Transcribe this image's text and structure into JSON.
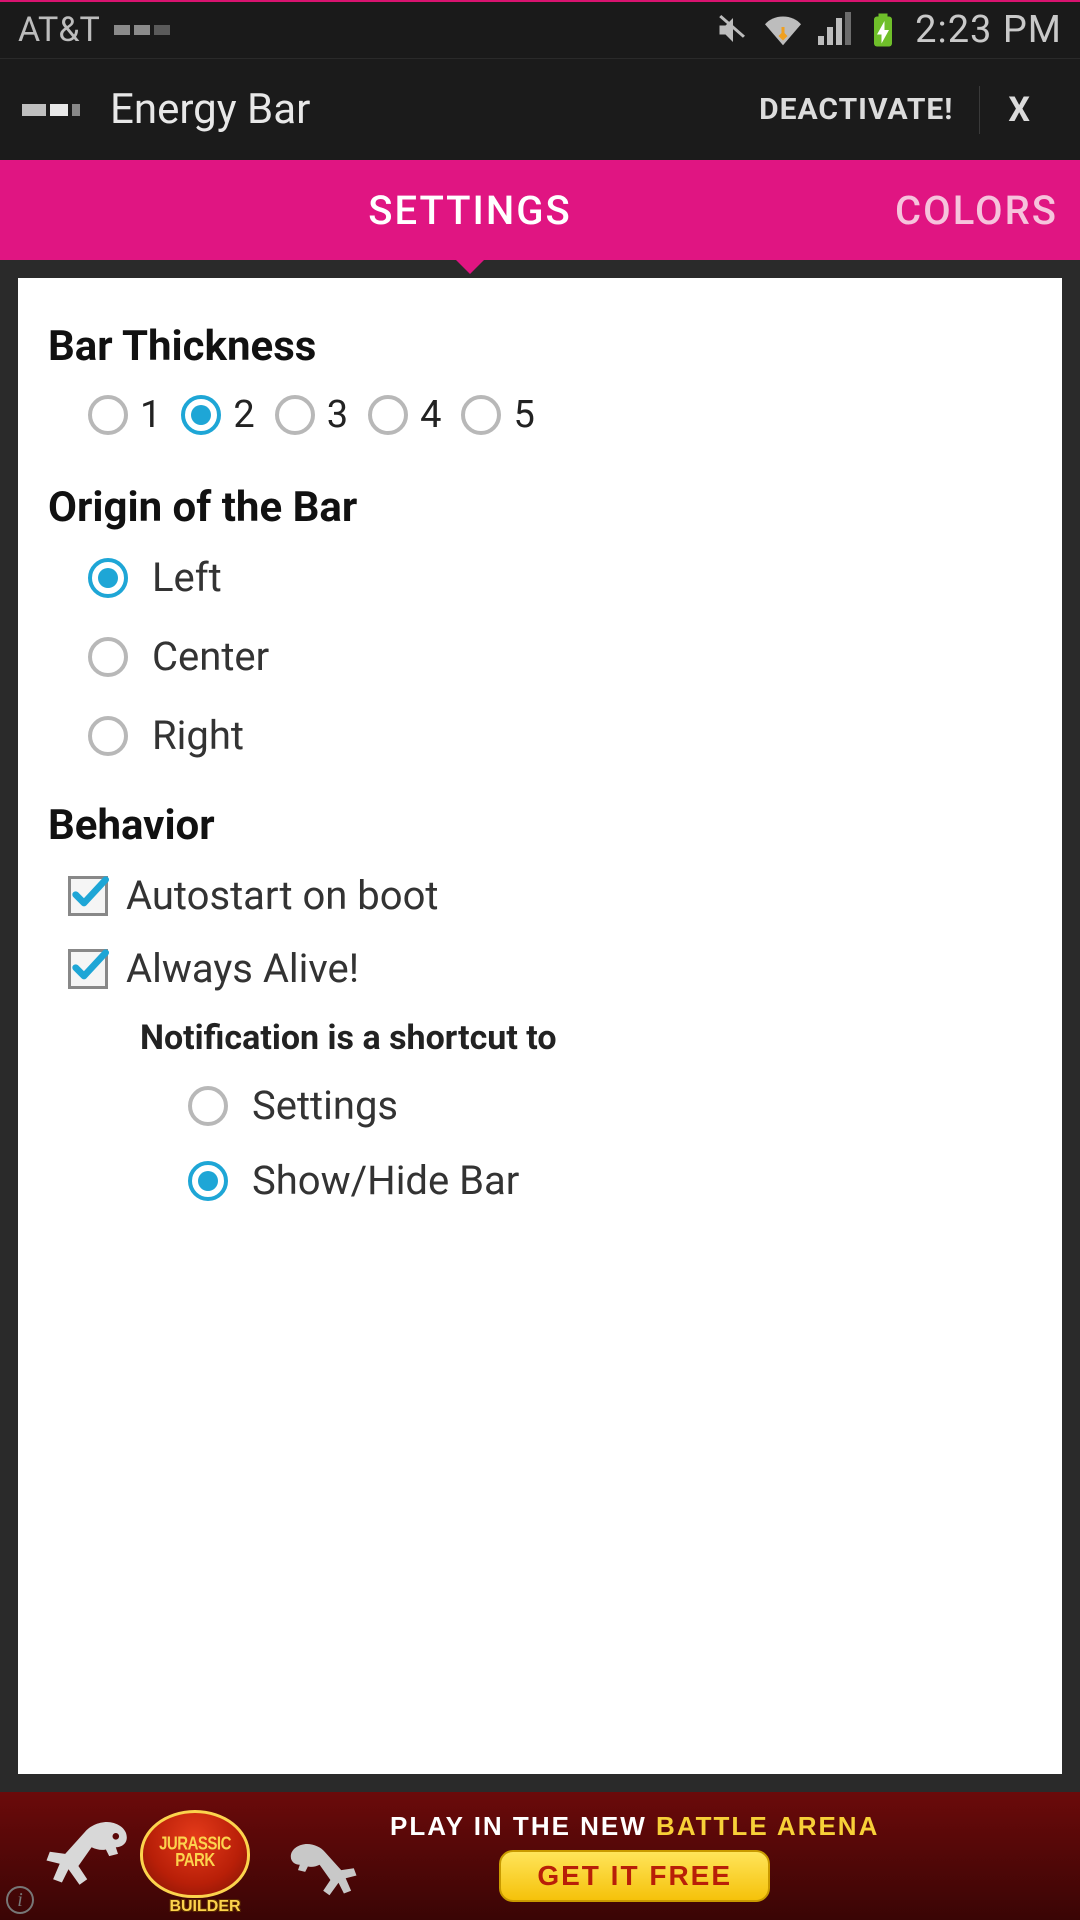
{
  "status": {
    "carrier": "AT&T",
    "time": "2:23 PM"
  },
  "appbar": {
    "title": "Energy Bar",
    "deactivate": "DEACTIVATE!",
    "close": "X"
  },
  "tabs": {
    "settings": "SETTINGS",
    "colors": "COLORS",
    "active": "settings"
  },
  "sections": {
    "thickness": {
      "title": "Bar Thickness",
      "options": [
        "1",
        "2",
        "3",
        "4",
        "5"
      ],
      "selected": "2"
    },
    "origin": {
      "title": "Origin of the Bar",
      "options": [
        "Left",
        "Center",
        "Right"
      ],
      "selected": "Left"
    },
    "behavior": {
      "title": "Behavior",
      "autostart": {
        "label": "Autostart on boot",
        "checked": true
      },
      "always_alive": {
        "label": "Always Alive!",
        "checked": true
      },
      "notification_heading": "Notification is a shortcut to",
      "notification_options": [
        "Settings",
        "Show/Hide Bar"
      ],
      "notification_selected": "Show/Hide Bar"
    }
  },
  "ad": {
    "line_white": "PLAY IN THE NEW ",
    "line_yellow": "BATTLE ARENA",
    "button": "GET IT FREE",
    "logo_top": "JURASSIC PARK",
    "logo_bottom": "BUILDER"
  }
}
